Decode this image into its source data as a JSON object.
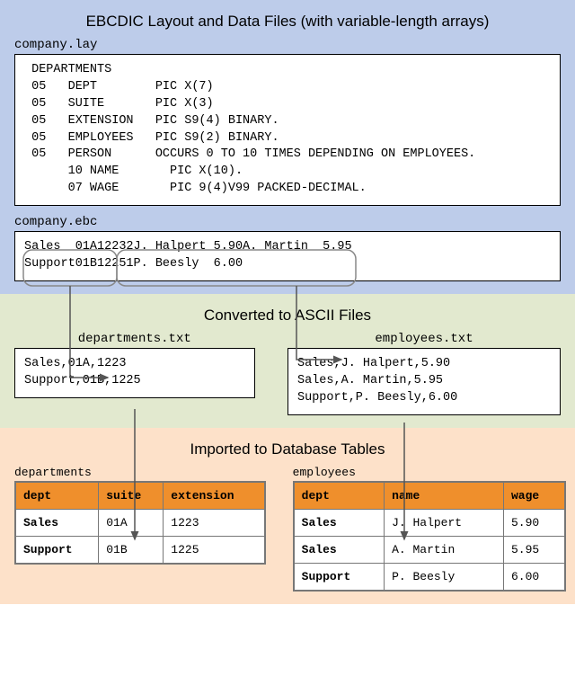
{
  "section1": {
    "title": "EBCDIC Layout and Data Files (with variable-length arrays)",
    "file1_name": "company.lay",
    "file1_content": " DEPARTMENTS\n 05   DEPT        PIC X(7)\n 05   SUITE       PIC X(3)\n 05   EXTENSION   PIC S9(4) BINARY.\n 05   EMPLOYEES   PIC S9(2) BINARY.\n 05   PERSON      OCCURS 0 TO 10 TIMES DEPENDING ON EMPLOYEES.\n      10 NAME       PIC X(10).\n      07 WAGE       PIC 9(4)V99 PACKED-DECIMAL.",
    "file2_name": "company.ebc",
    "file2_content": "Sales  01A12232J. Halpert 5.90A. Martin  5.95\nSupport01B12251P. Beesly  6.00"
  },
  "section2": {
    "title": "Converted to ASCII Files",
    "left_file": "departments.txt",
    "left_content": "Sales,01A,1223\nSupport,01B,1225",
    "right_file": "employees.txt",
    "right_content": "Sales,J. Halpert,5.90\nSales,A. Martin,5.95\nSupport,P. Beesly,6.00"
  },
  "section3": {
    "title": "Imported to Database Tables",
    "left_table": "departments",
    "left": {
      "headers": [
        "dept",
        "suite",
        "extension"
      ],
      "rows": [
        [
          "Sales",
          "01A",
          "1223"
        ],
        [
          "Support",
          "01B",
          "1225"
        ]
      ]
    },
    "right_table": "employees",
    "right": {
      "headers": [
        "dept",
        "name",
        "wage"
      ],
      "rows": [
        [
          "Sales",
          "J. Halpert",
          "5.90"
        ],
        [
          "Sales",
          "A. Martin",
          "5.95"
        ],
        [
          "Support",
          "P. Beesly",
          "6.00"
        ]
      ]
    }
  }
}
